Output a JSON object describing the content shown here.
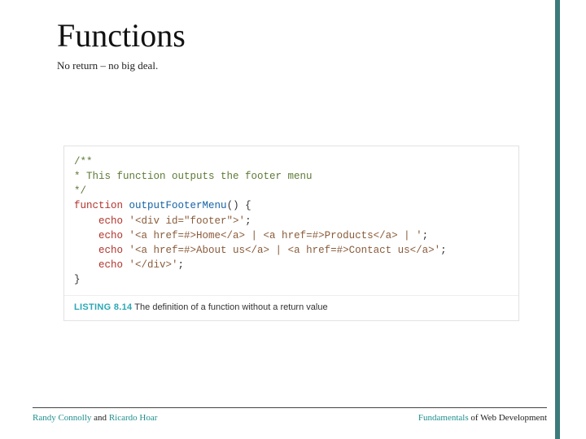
{
  "title": "Functions",
  "subtitle": "No return – no big deal.",
  "code": {
    "comment_open": "/**",
    "comment_line": "* This function outputs the footer menu",
    "comment_close": "*/",
    "kw_function": "function",
    "fn_name": "outputFooterMenu",
    "paren_open": "() {",
    "echo1_kw": "echo",
    "echo1_str": "'<div id=\"footer\">'",
    "semi": ";",
    "echo2_kw": "echo",
    "echo2_str": "'<a href=#>Home</a> | <a href=#>Products</a> | '",
    "echo3_kw": "echo",
    "echo3_str": "'<a href=#>About us</a> | <a href=#>Contact us</a>'",
    "echo4_kw": "echo",
    "echo4_str": "'</div>'",
    "brace_close": "}"
  },
  "caption": {
    "listing": "LISTING 8.14",
    "text": " The definition of a function without a return value"
  },
  "footer": {
    "left_teal1": "Randy Connolly",
    "left_and": " and ",
    "left_teal2": "Ricardo Hoar",
    "right_teal": "Fundamentals",
    "right_rest": " of Web Development"
  }
}
